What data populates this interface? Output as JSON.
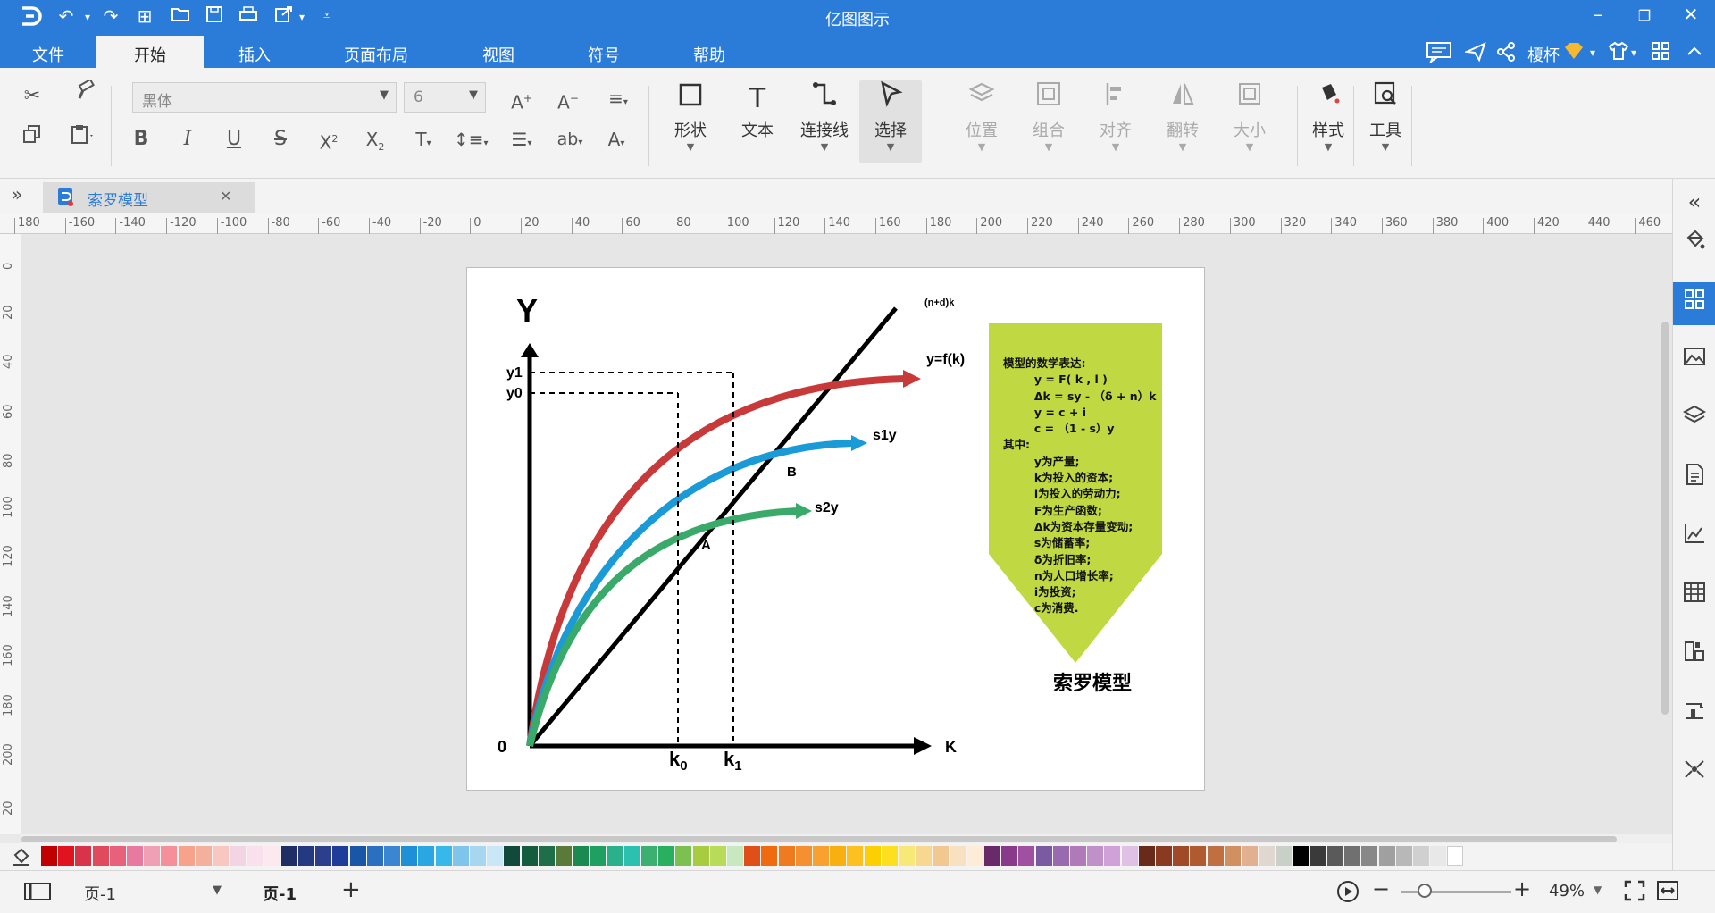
{
  "app": {
    "title": "亿图图示"
  },
  "colors": {
    "accent": "#2b7bd9"
  },
  "quick_access": {
    "icons": [
      "logo-icon",
      "undo-icon",
      "redo-icon",
      "new-icon",
      "open-icon",
      "save-icon",
      "print-icon",
      "export-icon",
      "customize-icon"
    ]
  },
  "menu": {
    "items": [
      "文件",
      "开始",
      "插入",
      "页面布局",
      "视图",
      "符号",
      "帮助"
    ],
    "active": "开始"
  },
  "account": {
    "user": "榎杯"
  },
  "ribbon": {
    "font_name": "黑体",
    "font_size": "6",
    "buttons": {
      "shape": "形状",
      "text": "文本",
      "connector": "连接线",
      "select": "选择",
      "position": "位置",
      "group": "组合",
      "align": "对齐",
      "flip": "翻转",
      "size": "大小",
      "style": "样式",
      "tools": "工具"
    }
  },
  "document_tab": {
    "name": "索罗模型"
  },
  "ruler": {
    "h_ticks": [
      "180",
      "-160",
      "-140",
      "-120",
      "-100",
      "-80",
      "-60",
      "-40",
      "-20",
      "0",
      "20",
      "40",
      "60",
      "80",
      "100",
      "120",
      "140",
      "160",
      "180",
      "200",
      "220",
      "240",
      "260",
      "280",
      "300",
      "320",
      "340",
      "360",
      "380",
      "400",
      "420",
      "440",
      "460"
    ],
    "v_ticks": [
      "0",
      "20",
      "40",
      "60",
      "80",
      "100",
      "120",
      "140",
      "160",
      "180",
      "200",
      "20"
    ]
  },
  "diagram": {
    "y_axis": "Y",
    "x_axis": "K",
    "origin": "0",
    "y1": "y1",
    "y0": "y0",
    "k0": "k",
    "k0_sub": "0",
    "k1": "k",
    "k1_sub": "1",
    "line_label": "(n+d)k",
    "curve_f": "y=f(k)",
    "curve_s1": "s1y",
    "curve_s2": "s2y",
    "point_a": "A",
    "point_b": "B",
    "box_lines": [
      "模型的数学表达:",
      "        y = F( k , l )",
      "        Δk = sy - （δ + n）k",
      "        y = c + i",
      "        c = （1 - s）y",
      "其中:",
      "        y为产量;",
      "        k为投入的资本;",
      "        l为投入的劳动力;",
      "        F为生产函数;",
      "        Δk为资本存量变动;",
      "        s为储蓄率;",
      "        δ为折旧率;",
      "        n为人口增长率;",
      "        i为投资;",
      "        c为消费."
    ],
    "caption": "索罗模型",
    "colors": {
      "f": "#c8393a",
      "s1": "#1a9ad6",
      "s2": "#3aaa6a",
      "box": "#c0d943"
    }
  },
  "palette": {
    "colors": [
      "#c00000",
      "#e0141e",
      "#d9334a",
      "#e04a5c",
      "#e8607a",
      "#e87aa0",
      "#f0a0b4",
      "#f5909a",
      "#f7a38b",
      "#f3b09c",
      "#f8c8c0",
      "#f2d4e4",
      "#f9e0ec",
      "#fbe9ef",
      "#1f2f66",
      "#233a80",
      "#2b3f8c",
      "#203c9a",
      "#1a56a8",
      "#2a6fc0",
      "#3a86d0",
      "#1e90d6",
      "#2aa6e2",
      "#38b8ea",
      "#7fc4ea",
      "#a7d6f0",
      "#cbe6f6",
      "#114a3a",
      "#145c3e",
      "#1e6e4a",
      "#5a7a3a",
      "#1a8a50",
      "#1fa060",
      "#2ab08a",
      "#2cc0b0",
      "#3cb070",
      "#28b060",
      "#7cc050",
      "#a8cc40",
      "#b8dc5a",
      "#c8e8c0",
      "#e04e1a",
      "#f06a10",
      "#f07a20",
      "#f49030",
      "#f8a030",
      "#f8b010",
      "#fcc020",
      "#fcd000",
      "#fce020",
      "#f8e878",
      "#f8d890",
      "#f0c890",
      "#f8e0c0",
      "#fcecd8",
      "#6a2a6a",
      "#8a3a8a",
      "#a050a0",
      "#7a5aa0",
      "#9a6ab0",
      "#b07ab8",
      "#c090c8",
      "#d0a0d8",
      "#e0c0e4",
      "#6a2a1a",
      "#8a3a20",
      "#a04a28",
      "#b05a30",
      "#c07040",
      "#d09060",
      "#e0b090",
      "#e0d8d0",
      "#c8d0c8",
      "#000000",
      "#3a3a3a",
      "#5a5a5a",
      "#707070",
      "#888888",
      "#a0a0a0",
      "#b8b8b8",
      "#d0d0d0",
      "#e8e8e8",
      "#ffffff"
    ]
  },
  "status": {
    "page_selector": "页-1",
    "page_tab": "页-1",
    "zoom": "49%",
    "zoom_level": 0.22
  }
}
